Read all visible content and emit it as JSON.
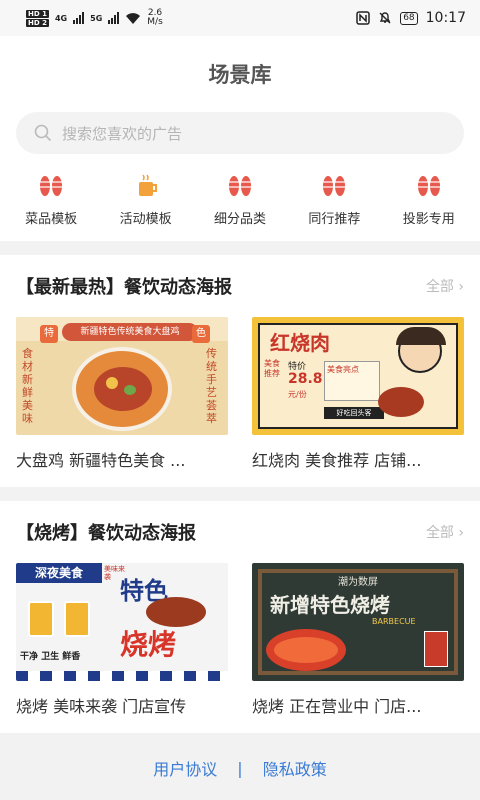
{
  "status_bar": {
    "hd1": "HD 1",
    "hd2": "HD 2",
    "net1": "4G",
    "net2": "5G",
    "speed": "2.6",
    "speed_unit": "M/s",
    "battery": "68",
    "time": "10:17"
  },
  "header": {
    "title": "场景库"
  },
  "search": {
    "placeholder": "搜索您喜欢的广告"
  },
  "categories": [
    {
      "label": "菜品模板",
      "icon": "shrimp-icon"
    },
    {
      "label": "活动模板",
      "icon": "drink-icon"
    },
    {
      "label": "细分品类",
      "icon": "shrimp-icon"
    },
    {
      "label": "同行推荐",
      "icon": "shrimp-icon"
    },
    {
      "label": "投影专用",
      "icon": "shrimp-icon"
    }
  ],
  "sections": [
    {
      "title": "【最新最热】餐饮动态海报",
      "more": "全部",
      "cards": [
        {
          "caption": "大盘鸡 新疆特色美食 ...",
          "poster_lines": [
            "新疆特色传统美食大盘鸡",
            "特",
            "色",
            "食材新鲜美味",
            "传统手艺荟萃"
          ]
        },
        {
          "caption": "红烧肉 美食推荐 店铺...",
          "poster_lines": [
            "红烧肉",
            "美食推荐",
            "特价",
            "28.8",
            "元/份",
            "美食亮点",
            "好吃回头客"
          ]
        }
      ]
    },
    {
      "title": "【烧烤】餐饮动态海报",
      "more": "全部",
      "cards": [
        {
          "caption": "烧烤 美味来袭 门店宣传",
          "poster_lines": [
            "深夜美食",
            "美味来袭",
            "特色",
            "烧烤",
            "干净 卫生 鲜香"
          ]
        },
        {
          "caption": "烧烤 正在营业中 门店...",
          "poster_lines": [
            "潮为数屏",
            "新增特色烧烤",
            "BARBECUE"
          ]
        }
      ]
    }
  ],
  "footer": {
    "agreement": "用户协议",
    "separator": "|",
    "privacy": "隐私政策"
  },
  "colors": {
    "accent_red": "#e8594d",
    "link_blue": "#3a7bd5",
    "icon_orange": "#f3a13a"
  }
}
